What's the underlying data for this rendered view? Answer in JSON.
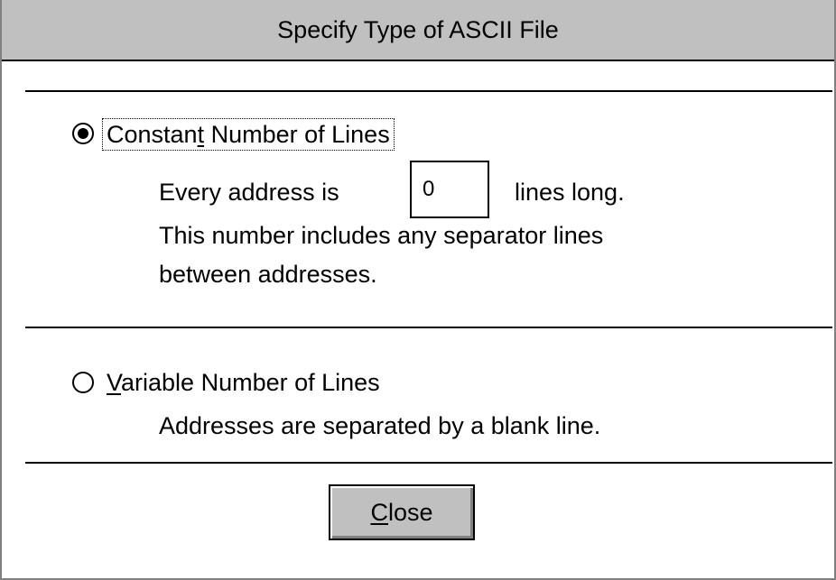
{
  "dialog": {
    "title": "Specify Type of ASCII File"
  },
  "constant_option": {
    "label_prefix": "Constan",
    "label_mnemonic": "t",
    "label_suffix": " Number of Lines",
    "selected": true,
    "every_prefix": "Every address is",
    "lines_value": "0",
    "every_suffix": "lines long.",
    "note_line1": "This number includes any separator lines",
    "note_line2": "between addresses."
  },
  "variable_option": {
    "label_mnemonic": "V",
    "label_suffix": "ariable Number of Lines",
    "selected": false,
    "description": "Addresses are separated by a blank line."
  },
  "buttons": {
    "close_mnemonic": "C",
    "close_suffix": "lose"
  },
  "colors": {
    "titlebar": "#c0c0c0",
    "button_face": "#c0c0c0",
    "background": "#ffffff"
  }
}
